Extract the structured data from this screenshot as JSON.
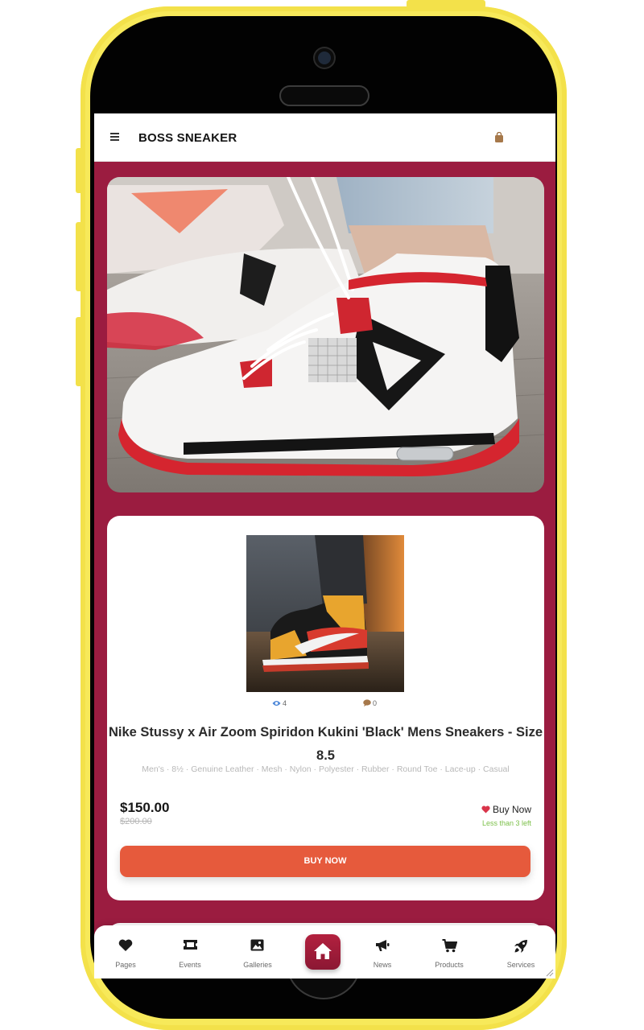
{
  "header": {
    "title": "BOSS SNEAKER"
  },
  "hero": {
    "image": "sneaker-hero-photo"
  },
  "product": {
    "views": "4",
    "comments": "0",
    "name": "Nike Stussy x Air Zoom Spiridon Kukini 'Black' Mens Sneakers - Size",
    "size": "8.5",
    "tags": "Men's · 8½ · Genuine Leather · Mesh · Nylon · Polyester · Rubber · Round Toe · Lace-up · Casual",
    "price": "$150.00",
    "old_price": "$200.00",
    "wishlist_label": "Buy Now",
    "stock_note": "Less than 3 left",
    "buy_button_label": "BUY NOW"
  },
  "bottom_nav": {
    "items": [
      {
        "label": "Pages",
        "icon": "heart-icon"
      },
      {
        "label": "Events",
        "icon": "ticket-icon"
      },
      {
        "label": "Galleries",
        "icon": "image-icon"
      },
      {
        "label": "News",
        "icon": "megaphone-icon"
      },
      {
        "label": "Products",
        "icon": "cart-icon"
      },
      {
        "label": "Services",
        "icon": "rocket-icon"
      }
    ],
    "home_icon": "home-icon"
  },
  "colors": {
    "screen_background": "#9b1c40",
    "accent_button": "#e65a3c",
    "phone_frame": "#f7e95a",
    "stock_note": "#7cc04a",
    "heart": "#d9344a"
  }
}
